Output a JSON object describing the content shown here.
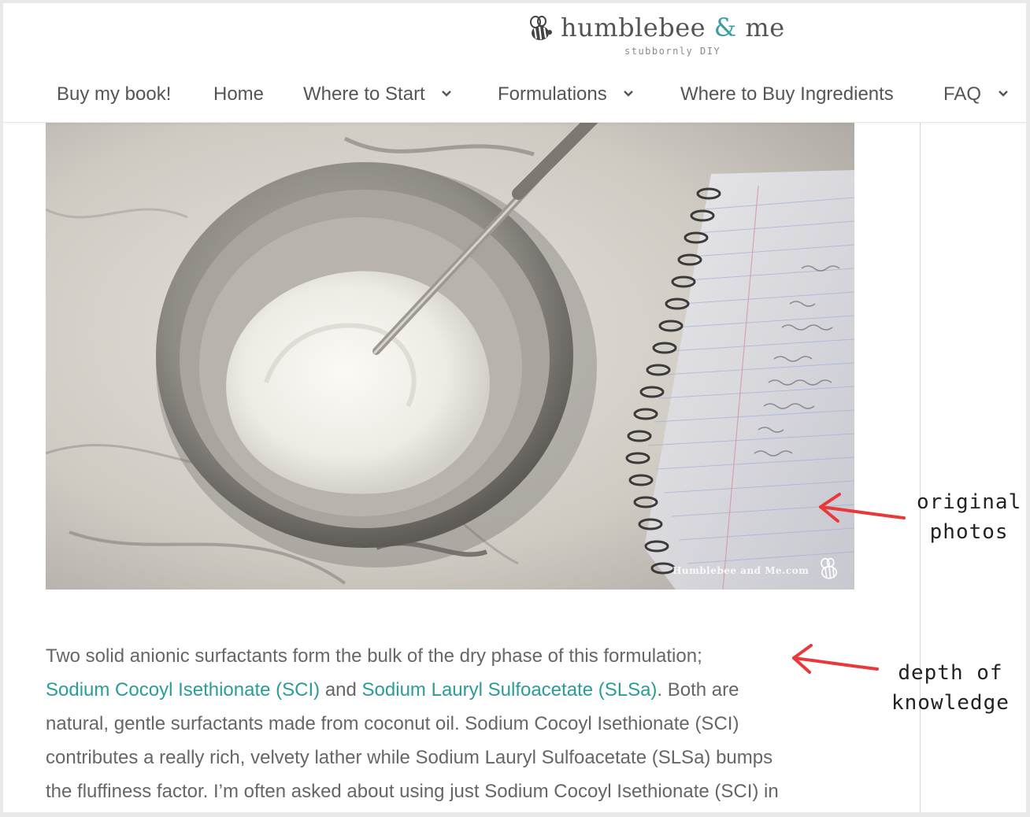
{
  "site": {
    "logo_name": "humblebee",
    "logo_amp": "&",
    "logo_me": "me",
    "tagline": "stubbornly DIY"
  },
  "nav": {
    "items": [
      {
        "label": "Buy my book!",
        "has_dropdown": false
      },
      {
        "label": "Home",
        "has_dropdown": false
      },
      {
        "label": "Where to Start",
        "has_dropdown": true
      },
      {
        "label": "Formulations",
        "has_dropdown": true
      },
      {
        "label": "Where to Buy Ingredients",
        "has_dropdown": false
      },
      {
        "label": "FAQ",
        "has_dropdown": true
      }
    ]
  },
  "photo": {
    "watermark": "Humblebee and Me.com"
  },
  "article": {
    "line1": "Two solid anionic surfactants form the bulk of the dry phase of this formulation;",
    "link1": "Sodium Cocoyl Isethionate (SCI)",
    "and_text": " and ",
    "link2": "Sodium Lauryl Sulfoacetate (SLSa)",
    "line2_rest": ". Both are",
    "line3": "natural, gentle surfactants made from coconut oil. Sodium Cocoyl Isethionate (SCI)",
    "line4": "contributes a really rich, velvety lather while Sodium Lauryl Sulfoacetate (SLSa) bumps",
    "line5": "the fluffiness factor. I’m often asked about using just Sodium Cocoyl Isethionate (SCI) in"
  },
  "annotations": {
    "photos_line1": "original",
    "photos_line2": "photos",
    "knowledge_line1": "depth of",
    "knowledge_line2": "knowledge"
  },
  "colors": {
    "link": "#2b9c98",
    "accent": "#3a9ea3",
    "arrow": "#e8383a",
    "text": "#666666",
    "nav_text": "#555555"
  }
}
